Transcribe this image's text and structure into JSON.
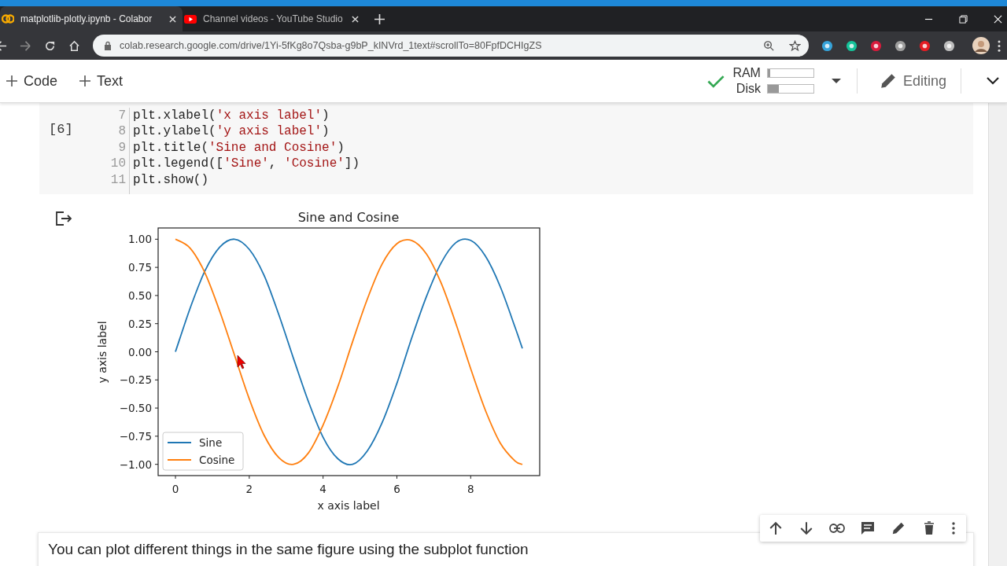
{
  "browser": {
    "tabs": [
      {
        "title": "matplotlib-plotly.ipynb - Colabor",
        "selected": true,
        "kind": "colab"
      },
      {
        "title": "Channel videos - YouTube Studio",
        "selected": false,
        "kind": "youtube"
      }
    ],
    "url": "colab.research.google.com/drive/1Yi-5fKg8o7Qsba-g9bP_kINVrd_1text#scrollTo=80FpfDCHIgZS"
  },
  "toolbar": {
    "add_code": "Code",
    "add_text": "Text",
    "ram": {
      "label": "RAM",
      "level": 0.05
    },
    "disk": {
      "label": "Disk",
      "level": 0.25
    },
    "mode": "Editing"
  },
  "code_cell": {
    "exec_count": "[6]",
    "lines": [
      {
        "number": "7",
        "tokens": [
          {
            "text": "plt.xlabel(",
            "kind": "plain"
          },
          {
            "text": "'x axis label'",
            "kind": "string"
          },
          {
            "text": ")",
            "kind": "plain"
          }
        ]
      },
      {
        "number": "8",
        "tokens": [
          {
            "text": "plt.ylabel(",
            "kind": "plain"
          },
          {
            "text": "'y axis label'",
            "kind": "string"
          },
          {
            "text": ")",
            "kind": "plain"
          }
        ]
      },
      {
        "number": "9",
        "tokens": [
          {
            "text": "plt.title(",
            "kind": "plain"
          },
          {
            "text": "'Sine and Cosine'",
            "kind": "string"
          },
          {
            "text": ")",
            "kind": "plain"
          }
        ]
      },
      {
        "number": "10",
        "tokens": [
          {
            "text": "plt.legend([",
            "kind": "plain"
          },
          {
            "text": "'Sine'",
            "kind": "string"
          },
          {
            "text": ", ",
            "kind": "plain"
          },
          {
            "text": "'Cosine'",
            "kind": "string"
          },
          {
            "text": "])",
            "kind": "plain"
          }
        ]
      },
      {
        "number": "11",
        "tokens": [
          {
            "text": "plt.show()",
            "kind": "plain"
          }
        ]
      }
    ]
  },
  "output": {
    "chart_data": {
      "type": "line",
      "title": "Sine and Cosine",
      "xlabel": "x axis label",
      "ylabel": "y axis label",
      "x": [
        0,
        0.4,
        0.8,
        1.2,
        1.6,
        2.0,
        2.4,
        2.8,
        3.2,
        3.6,
        4.0,
        4.4,
        4.8,
        5.2,
        5.6,
        6.0,
        6.4,
        6.8,
        7.2,
        7.6,
        8.0,
        8.4,
        8.8,
        9.2,
        9.4
      ],
      "series": [
        {
          "name": "Sine",
          "color": "#1f77b4",
          "values": [
            0,
            0.39,
            0.72,
            0.93,
            1.0,
            0.91,
            0.68,
            0.33,
            -0.06,
            -0.44,
            -0.76,
            -0.95,
            -1.0,
            -0.88,
            -0.63,
            -0.28,
            0.12,
            0.49,
            0.79,
            0.97,
            0.99,
            0.85,
            0.58,
            0.22,
            0.03
          ]
        },
        {
          "name": "Cosine",
          "color": "#ff7f0e",
          "values": [
            1,
            0.92,
            0.7,
            0.36,
            -0.03,
            -0.42,
            -0.74,
            -0.94,
            -1.0,
            -0.9,
            -0.65,
            -0.31,
            0.09,
            0.47,
            0.78,
            0.96,
            0.99,
            0.87,
            0.61,
            0.25,
            -0.15,
            -0.52,
            -0.81,
            -0.97,
            -1.0
          ]
        }
      ],
      "legend": true,
      "xlim": [
        -0.47,
        9.87
      ],
      "ylim": [
        -1.1,
        1.1
      ],
      "xticks": [
        0,
        2,
        4,
        6,
        8
      ],
      "yticks": [
        {
          "value": 1,
          "label": "1.00"
        },
        {
          "value": 0.75,
          "label": "0.75"
        },
        {
          "value": 0.5,
          "label": "0.50"
        },
        {
          "value": 0.25,
          "label": "0.25"
        },
        {
          "value": 0,
          "label": "0.00"
        },
        {
          "value": -0.25,
          "label": "−0.25"
        },
        {
          "value": -0.5,
          "label": "−0.50"
        },
        {
          "value": -0.75,
          "label": "−0.75"
        },
        {
          "value": -1,
          "label": "−1.00"
        }
      ]
    }
  },
  "text_cell": {
    "text": "You can plot different things in the same figure using the subplot function"
  }
}
